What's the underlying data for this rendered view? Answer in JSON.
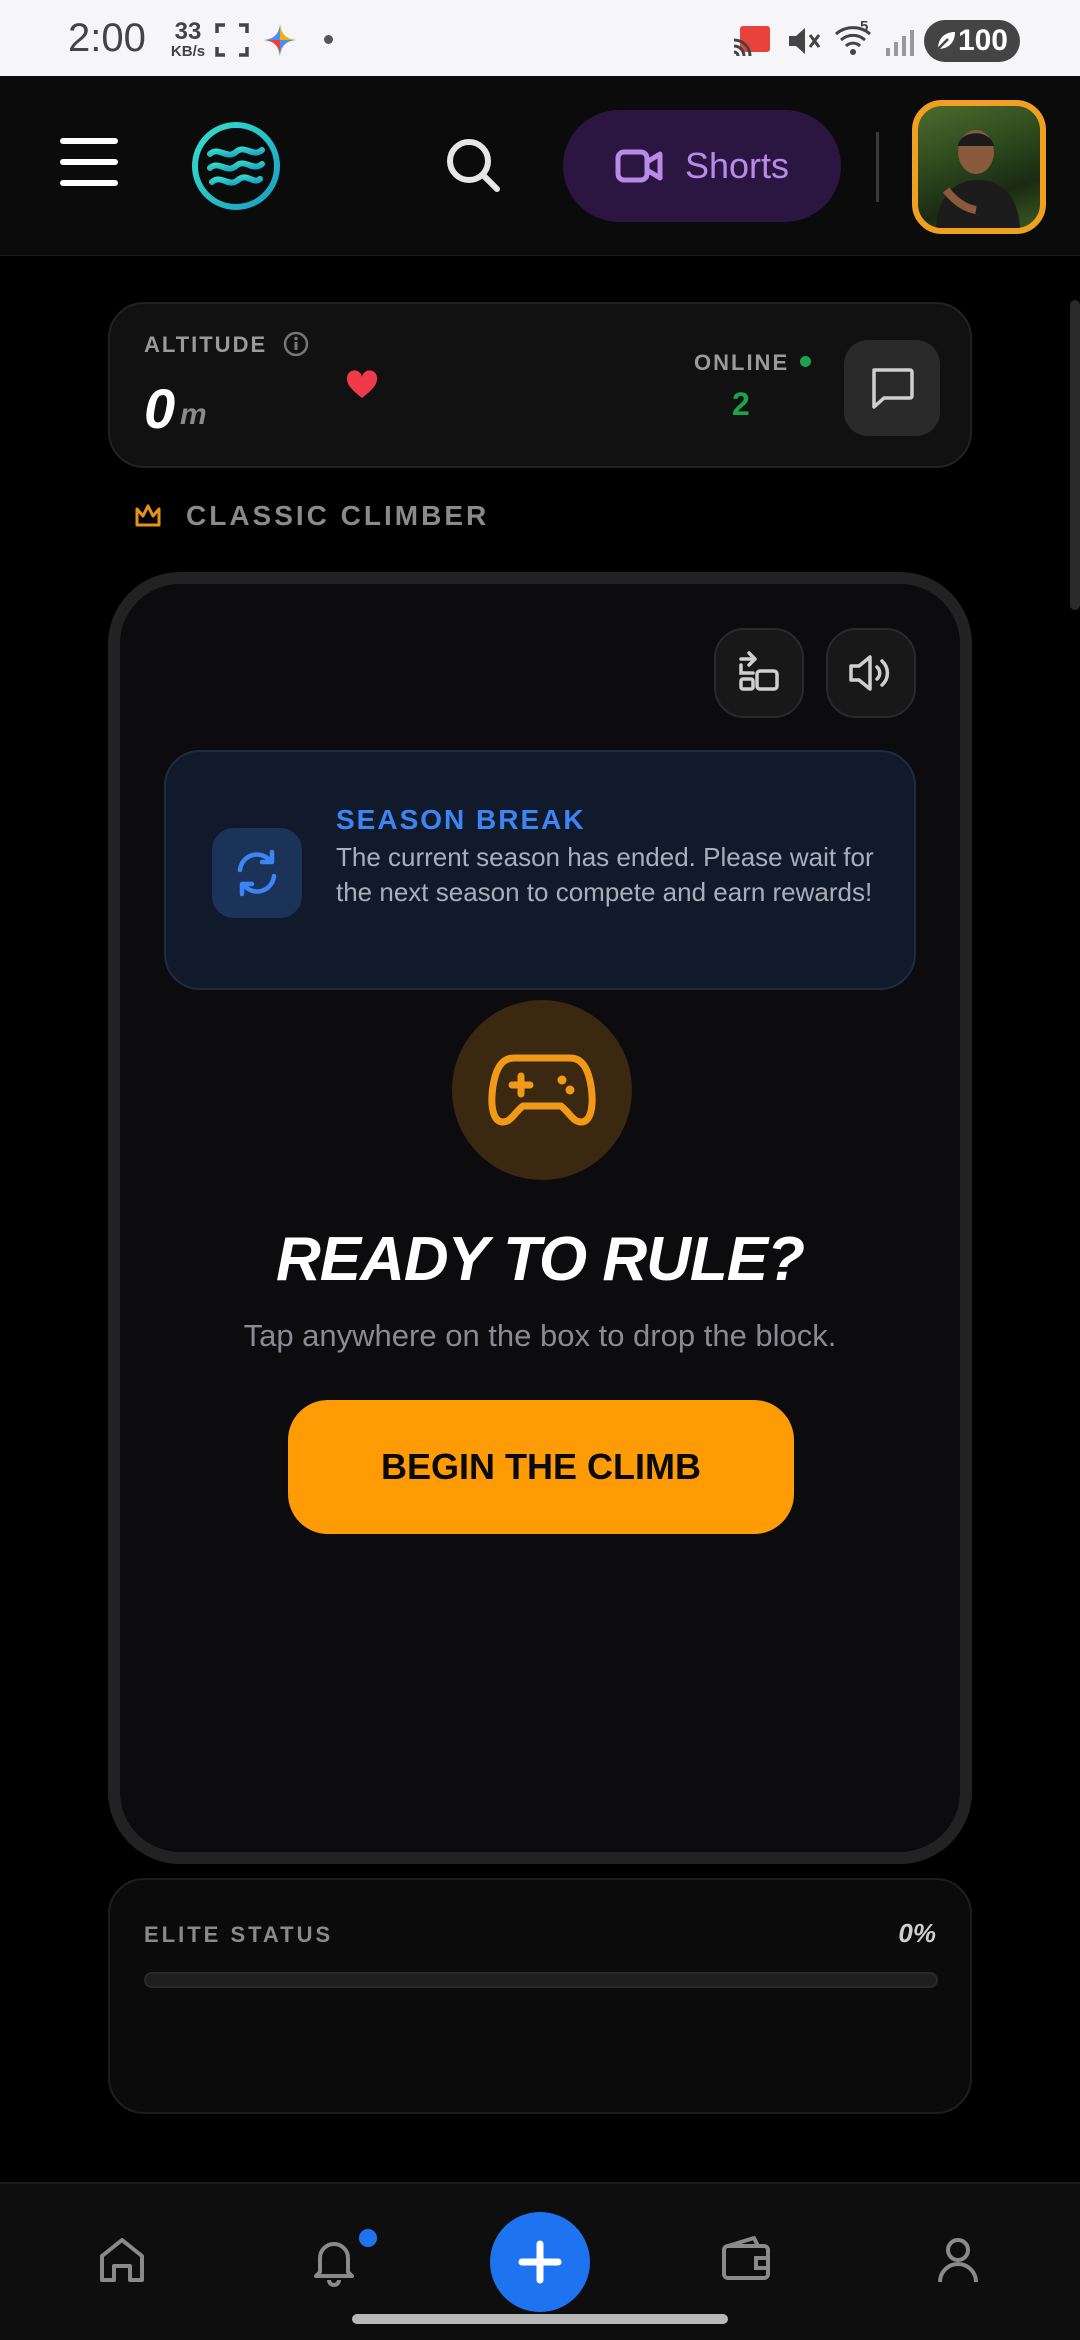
{
  "status_bar": {
    "time": "2:00",
    "speed_value": "33",
    "speed_unit": "KB/s",
    "battery": "100",
    "signal_label": "5"
  },
  "header": {
    "shorts_label": "Shorts",
    "accent_shorts": "#b98be8"
  },
  "altitude": {
    "label": "ALTITUDE",
    "value": "0",
    "unit": "m",
    "online_label": "ONLINE",
    "online_count": "2"
  },
  "mode": {
    "label": "CLASSIC CLIMBER"
  },
  "game": {
    "season_title": "SEASON BREAK",
    "season_text": "The current season has ended. Please wait for the next season to compete and earn rewards!",
    "ready_title": "READY TO RULE?",
    "ready_subtitle": "Tap anywhere on the box to drop the block.",
    "begin_button": "BEGIN THE CLIMB",
    "accent": "#ff9b05"
  },
  "elite": {
    "label": "ELITE STATUS",
    "percent_text": "0%",
    "progress": 0
  },
  "bottom_nav": {
    "items": [
      "home-icon",
      "bell-icon",
      "plus-icon",
      "wallet-icon",
      "profile-icon"
    ],
    "accent": "#1e74f0"
  }
}
